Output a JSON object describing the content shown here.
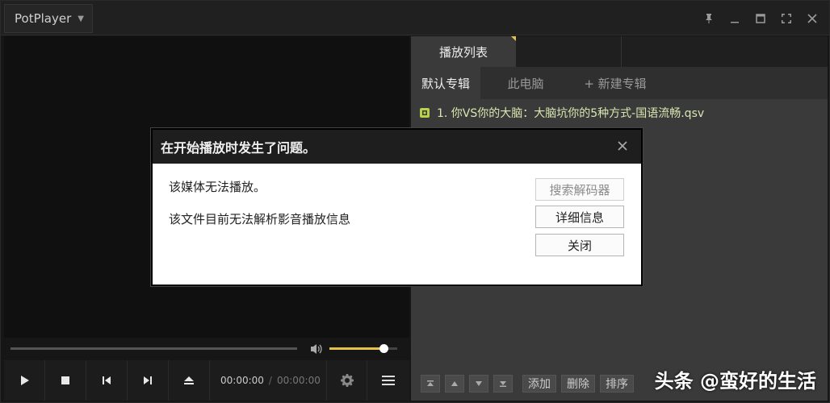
{
  "app": {
    "title": "PotPlayer"
  },
  "player": {
    "time_current": "00:00:00",
    "time_separator": "/",
    "time_total": "00:00:00",
    "volume_fraction": 0.8
  },
  "playlist": {
    "main_tab": "播放列表",
    "album_tabs": [
      "默认专辑",
      "此电脑",
      "+ 新建专辑"
    ],
    "items": [
      "1. 你VS你的大脑：大脑坑你的5种方式-国语流畅.qsv"
    ],
    "bottom_buttons": {
      "add": "添加",
      "delete": "删除",
      "sort": "排序"
    }
  },
  "dialog": {
    "title": "在开始播放时发生了问题。",
    "message1": "该媒体无法播放。",
    "message2": "该文件目前无法解析影音播放信息",
    "btn_search": "搜索解码器",
    "btn_details": "详细信息",
    "btn_close": "关闭"
  },
  "watermark": "头条 @蛮好的生活",
  "colors": {
    "accent": "#e6c24a",
    "playlist_item": "#d9e7b0"
  }
}
